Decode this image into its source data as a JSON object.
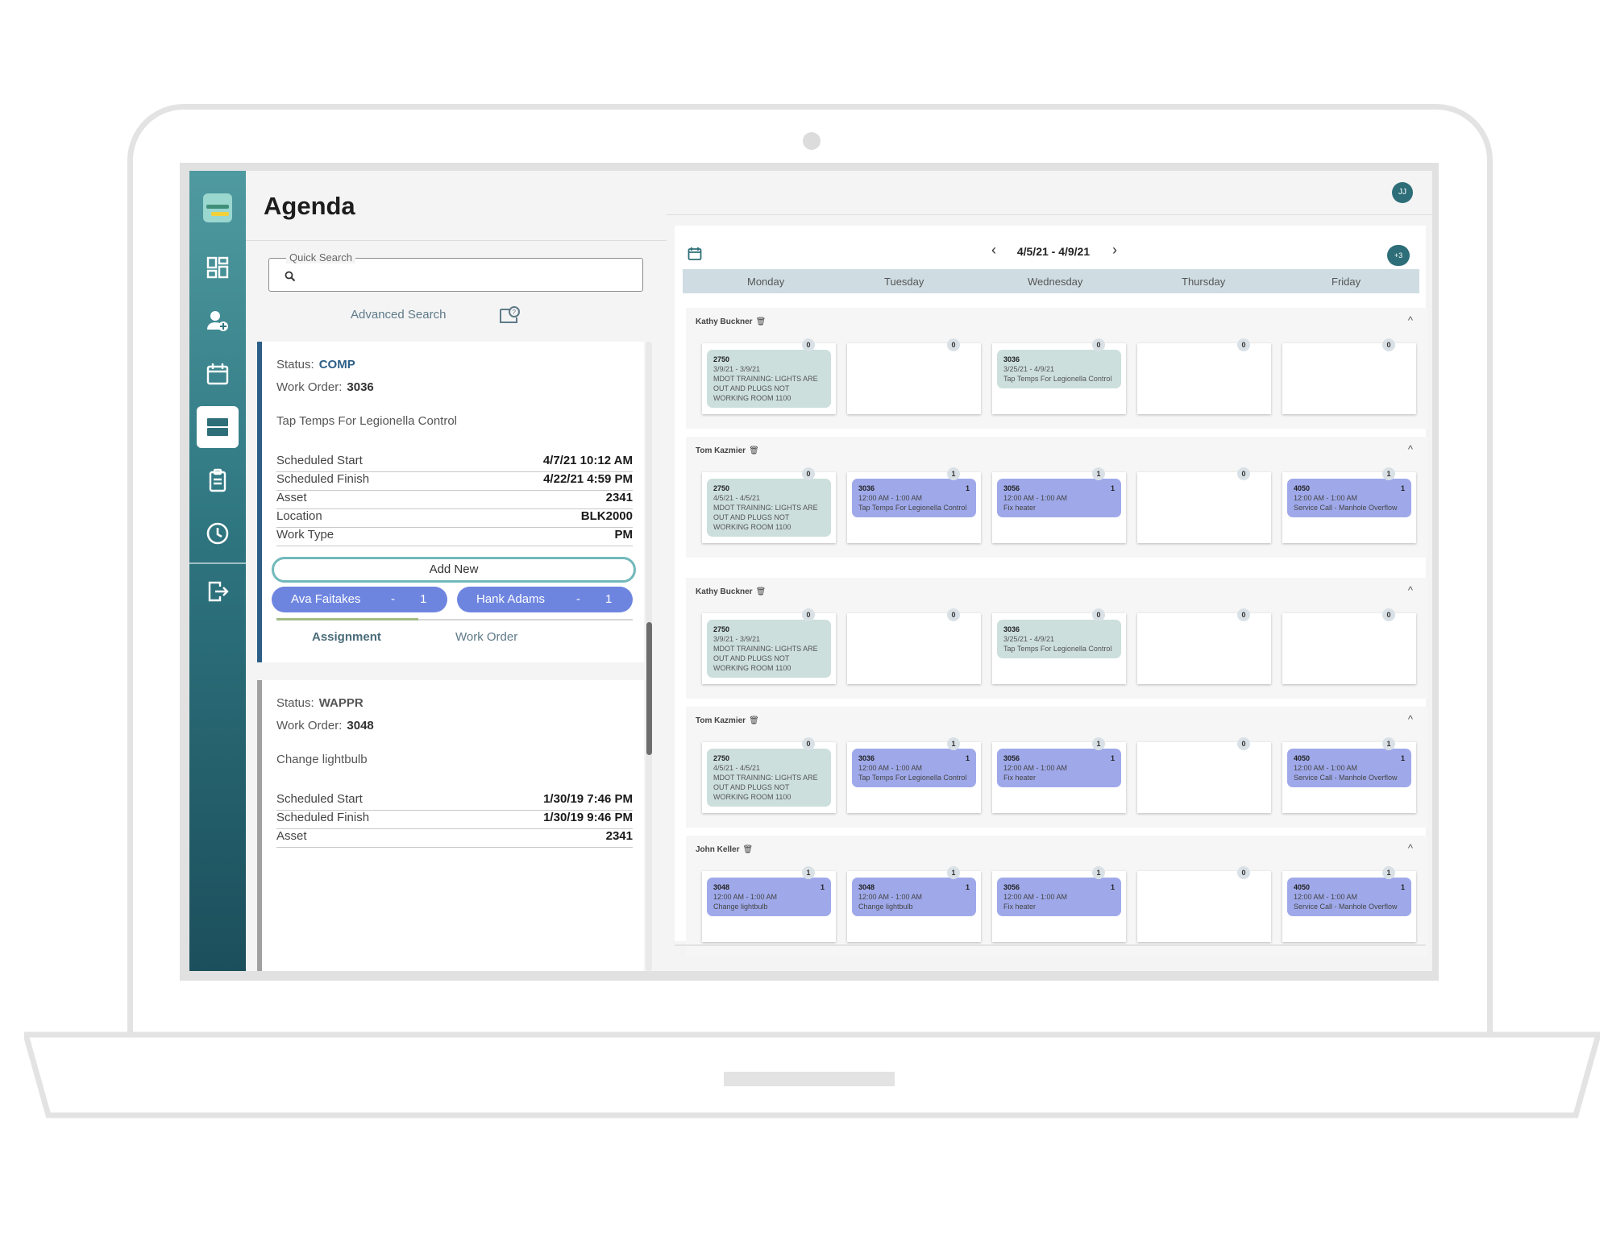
{
  "app": {
    "page_title": "Agenda",
    "avatar_initials": "JJ"
  },
  "search": {
    "label": "Quick Search",
    "placeholder": "",
    "value": "",
    "advanced_label": "Advanced Search"
  },
  "work_orders": [
    {
      "status_label": "Status:",
      "status": "COMP",
      "wo_label": "Work Order:",
      "wo": "3036",
      "description": "Tap Temps For Legionella Control",
      "fields": [
        {
          "label": "Scheduled Start",
          "value": "4/7/21 10:12 AM"
        },
        {
          "label": "Scheduled Finish",
          "value": "4/22/21 4:59 PM"
        },
        {
          "label": "Asset",
          "value": "2341"
        },
        {
          "label": "Location",
          "value": "BLK2000"
        },
        {
          "label": "Work Type",
          "value": "PM"
        }
      ],
      "add_new_label": "Add New",
      "assignees": [
        {
          "name": "Ava Faitakes",
          "sep": "-",
          "count": "1"
        },
        {
          "name": "Hank Adams",
          "sep": "-",
          "count": "1"
        }
      ],
      "tabs": [
        "Assignment",
        "Work Order"
      ]
    },
    {
      "status_label": "Status:",
      "status": "WAPPR",
      "wo_label": "Work Order:",
      "wo": "3048",
      "description": "Change lightbulb",
      "fields": [
        {
          "label": "Scheduled Start",
          "value": "1/30/19 7:46 PM"
        },
        {
          "label": "Scheduled Finish",
          "value": "1/30/19 9:46 PM"
        },
        {
          "label": "Asset",
          "value": "2341"
        }
      ]
    }
  ],
  "schedule": {
    "date_range": "4/5/21 - 4/9/21",
    "prev_label": "‹",
    "next_label": "›",
    "overflow_badge": "+3",
    "days": [
      "Monday",
      "Tuesday",
      "Wednesday",
      "Thursday",
      "Friday"
    ],
    "trash_glyph": "🗑",
    "collapse_glyph": "^",
    "resources": [
      {
        "name": "Kathy Buckner",
        "cells": [
          {
            "count": "0",
            "event": {
              "id": "2750",
              "time": "3/9/21 - 3/9/21",
              "text": "MDOT TRAINING: LIGHTS ARE OUT AND PLUGS NOT WORKING ROOM 1100",
              "badge": ""
            }
          },
          {
            "count": "0"
          },
          {
            "count": "0",
            "event": {
              "id": "3036",
              "time": "3/25/21 - 4/9/21",
              "text": "Tap Temps For Legionella Control",
              "badge": ""
            }
          },
          {
            "count": "0"
          },
          {
            "count": "0"
          }
        ]
      },
      {
        "name": "Tom Kazmier",
        "cells": [
          {
            "count": "0",
            "event": {
              "id": "2750",
              "time": "4/5/21 - 4/5/21",
              "text": "MDOT TRAINING: LIGHTS ARE OUT AND PLUGS NOT WORKING ROOM 1100",
              "badge": ""
            }
          },
          {
            "count": "1",
            "event": {
              "id": "3036",
              "time": "12:00 AM - 1:00 AM",
              "text": "Tap Temps For Legionella Control",
              "badge": "1"
            }
          },
          {
            "count": "1",
            "event": {
              "id": "3056",
              "time": "12:00 AM - 1:00 AM",
              "text": "Fix heater",
              "badge": "1"
            }
          },
          {
            "count": "0"
          },
          {
            "count": "1",
            "event": {
              "id": "4050",
              "time": "12:00 AM - 1:00 AM",
              "text": "Service Call - Manhole Overflow",
              "badge": "1"
            }
          }
        ]
      },
      {
        "name": "Kathy Buckner",
        "cells": [
          {
            "count": "0",
            "event": {
              "id": "2750",
              "time": "3/9/21 - 3/9/21",
              "text": "MDOT TRAINING: LIGHTS ARE OUT AND PLUGS NOT WORKING ROOM 1100",
              "badge": ""
            }
          },
          {
            "count": "0"
          },
          {
            "count": "0",
            "event": {
              "id": "3036",
              "time": "3/25/21 - 4/9/21",
              "text": "Tap Temps For Legionella Control",
              "badge": ""
            }
          },
          {
            "count": "0"
          },
          {
            "count": "0"
          }
        ]
      },
      {
        "name": "Tom Kazmier",
        "cells": [
          {
            "count": "0",
            "event": {
              "id": "2750",
              "time": "4/5/21 - 4/5/21",
              "text": "MDOT TRAINING: LIGHTS ARE OUT AND PLUGS NOT WORKING ROOM 1100",
              "badge": ""
            }
          },
          {
            "count": "1",
            "event": {
              "id": "3036",
              "time": "12:00 AM - 1:00 AM",
              "text": "Tap Temps For Legionella Control",
              "badge": "1"
            }
          },
          {
            "count": "1",
            "event": {
              "id": "3056",
              "time": "12:00 AM - 1:00 AM",
              "text": "Fix heater",
              "badge": "1"
            }
          },
          {
            "count": "0"
          },
          {
            "count": "1",
            "event": {
              "id": "4050",
              "time": "12:00 AM - 1:00 AM",
              "text": "Service Call - Manhole Overflow",
              "badge": "1"
            }
          }
        ]
      },
      {
        "name": "John Keller",
        "cells": [
          {
            "count": "1",
            "event": {
              "id": "3048",
              "time": "12:00 AM - 1:00 AM",
              "text": "Change lightbulb",
              "badge": "1"
            }
          },
          {
            "count": "1",
            "event": {
              "id": "3048",
              "time": "12:00 AM - 1:00 AM",
              "text": "Change lightbulb",
              "badge": "1"
            }
          },
          {
            "count": "1",
            "event": {
              "id": "3056",
              "time": "12:00 AM - 1:00 AM",
              "text": "Fix heater",
              "badge": "1"
            }
          },
          {
            "count": "0"
          },
          {
            "count": "1",
            "event": {
              "id": "4050",
              "time": "12:00 AM - 1:00 AM",
              "text": "Service Call - Manhole Overflow",
              "badge": "1"
            }
          }
        ]
      }
    ]
  },
  "icons": {
    "rail": [
      "dashboard-icon",
      "add-user-icon",
      "calendar-icon",
      "agenda-icon",
      "clipboard-icon",
      "clock-icon",
      "logout-icon"
    ]
  },
  "colors": {
    "accent": "#2e6e78",
    "status_comp": "#2c5f88",
    "event_assigned": "#9fa9ea",
    "event_pending": "#ccdfdd"
  }
}
